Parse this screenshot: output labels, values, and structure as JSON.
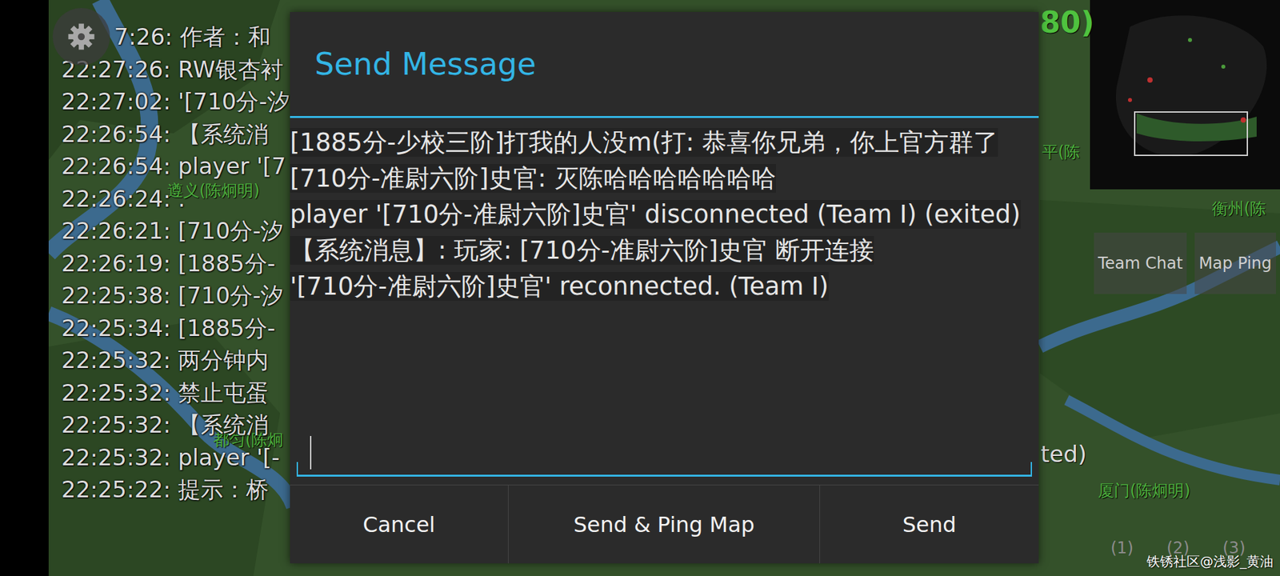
{
  "game": {
    "chat_log": [
      "7:26: 作者：和",
      "22:27:26: RW银杏衬",
      "22:27:02: '[710分-汐",
      "22:26:54: 【系统消",
      "22:26:54: player '[7",
      "22:26:24: .",
      "22:26:21: [710分-汐",
      "22:26:19: [1885分-",
      "22:25:38: [710分-汐",
      "22:25:34: [1885分-",
      "22:25:32: 两分钟内",
      "22:25:32: 禁止屯蛋",
      "22:25:32: 【系统消",
      "22:25:32: player '[-",
      "22:25:22: 提示：桥"
    ],
    "overlay_labels": [
      {
        "text": "80)",
        "kind": "score"
      },
      {
        "text": "平(陈",
        "kind": "territory"
      },
      {
        "text": "衡州(陈",
        "kind": "territory"
      },
      {
        "text": "遵义(陈炯明)",
        "kind": "territory"
      },
      {
        "text": "都匀(陈炯",
        "kind": "territory"
      },
      {
        "text": "厦门(陈炯明)",
        "kind": "territory"
      },
      {
        "text": "ted)",
        "kind": "chat"
      }
    ]
  },
  "hud": {
    "buttons": [
      "Team Chat",
      "Map Ping"
    ],
    "group_slots": [
      "(1)",
      "(2)",
      "(3)"
    ]
  },
  "dialog": {
    "title": "Send Message",
    "messages": [
      "[1885分-少校三阶]打我的人没m(打: 恭喜你兄弟，你上官方群了",
      "[710分-准尉六阶]史官: 灭陈哈哈哈哈哈哈哈",
      "player '[710分-准尉六阶]史官' disconnected (Team I) (exited)",
      "【系统消息】: 玩家: [710分-准尉六阶]史官 断开连接",
      "'[710分-准尉六阶]史官' reconnected. (Team I)"
    ],
    "input": {
      "value": "",
      "focused": true
    },
    "buttons": [
      "Cancel",
      "Send & Ping Map",
      "Send"
    ]
  },
  "watermark": "铁锈社区@浅影_黄油"
}
